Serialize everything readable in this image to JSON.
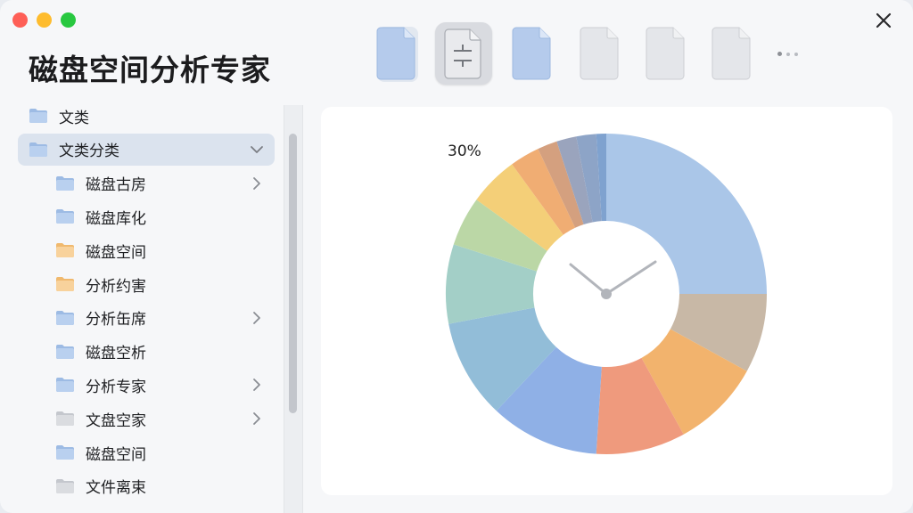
{
  "window": {
    "title": "磁盘空间分析专家",
    "controls": {
      "close": "close",
      "minimize": "minimize",
      "zoom": "zoom"
    }
  },
  "toolbar": {
    "buttons": [
      {
        "icon": "document-blue-icon"
      },
      {
        "icon": "filter-document-icon",
        "selected": true
      },
      {
        "icon": "document-blue-icon"
      },
      {
        "icon": "document-gray-icon"
      },
      {
        "icon": "document-gray-icon"
      },
      {
        "icon": "document-gray-icon"
      }
    ],
    "more_icon": "more-dots-icon"
  },
  "sidebar": {
    "items": [
      {
        "label": "文类",
        "icon": "folder-blue-icon",
        "indent": 0
      },
      {
        "label": "文类分类",
        "icon": "folder-blue-icon",
        "indent": 0,
        "selected": true,
        "expanded": true
      },
      {
        "label": "磁盘古房",
        "icon": "folder-blue-icon",
        "indent": 1,
        "chevron": true
      },
      {
        "label": "磁盘库化",
        "icon": "folder-blue-icon",
        "indent": 1
      },
      {
        "label": "磁盘空间",
        "icon": "folder-orange-icon",
        "indent": 1
      },
      {
        "label": "分析约害",
        "icon": "folder-orange-icon",
        "indent": 1
      },
      {
        "label": "分析缶席",
        "icon": "folder-blue-icon",
        "indent": 1,
        "chevron": true
      },
      {
        "label": "磁盘空析",
        "icon": "folder-blue-icon",
        "indent": 1
      },
      {
        "label": "分析专家",
        "icon": "folder-blue-icon",
        "indent": 1,
        "chevron": true
      },
      {
        "label": "文盘空家",
        "icon": "folder-gray-icon",
        "indent": 1,
        "chevron": true
      },
      {
        "label": "磁盘空间",
        "icon": "folder-blue-icon",
        "indent": 1
      },
      {
        "label": "文件离束",
        "icon": "folder-gray-icon",
        "indent": 1
      }
    ]
  },
  "main": {
    "chart_label": "30%",
    "center_icon": "clock-icon"
  },
  "colors": {
    "accent": "#dbe3ee",
    "folder_blue": "#8fb3e0",
    "folder_orange": "#f5c07a",
    "folder_gray": "#c9ccd2"
  },
  "chart_data": {
    "type": "donut",
    "title": "",
    "annotations": [
      "30%"
    ],
    "slices": [
      {
        "value": 25,
        "color": "#aac6e8"
      },
      {
        "value": 8,
        "color": "#c8b8a6"
      },
      {
        "value": 9,
        "color": "#f2b36d"
      },
      {
        "value": 9,
        "color": "#ef9a7d"
      },
      {
        "value": 11,
        "color": "#8fb0e6"
      },
      {
        "value": 10,
        "color": "#92bdd8"
      },
      {
        "value": 8,
        "color": "#a3cfc7"
      },
      {
        "value": 5,
        "color": "#bbd7a6"
      },
      {
        "value": 5,
        "color": "#f4cf78"
      },
      {
        "value": 3,
        "color": "#f0ad73"
      },
      {
        "value": 2,
        "color": "#d4a07f"
      },
      {
        "value": 2,
        "color": "#9aa4bd"
      },
      {
        "value": 2,
        "color": "#8da4c7"
      },
      {
        "value": 1,
        "color": "#7fa2cf"
      }
    ]
  }
}
